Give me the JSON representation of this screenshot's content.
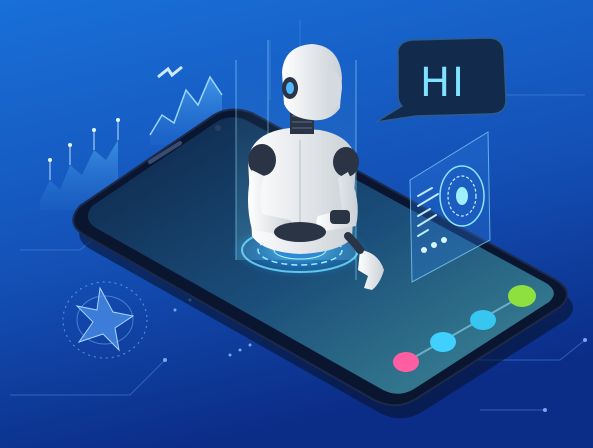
{
  "speech_bubble": {
    "text": "HI"
  },
  "colors": {
    "background_top": "#1463c9",
    "background_bottom": "#0c2f8a",
    "phone_body": "#0a1530",
    "screen": "#15345e",
    "robot_body": "#e8ecef",
    "robot_joint": "#2a3444",
    "hologram": "#3fd0ff",
    "dot_pink": "#ff5fa2",
    "dot_cyan_1": "#3fd0ff",
    "dot_cyan_2": "#36c6f0",
    "dot_green": "#8ee03f"
  },
  "icons": [
    "robot",
    "smartphone",
    "speech-bubble",
    "area-chart",
    "line-chart",
    "circuit-dial-panel",
    "radar-star-chart"
  ]
}
